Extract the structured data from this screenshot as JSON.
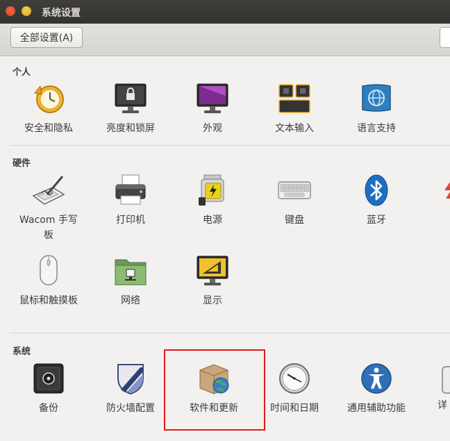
{
  "window": {
    "title": "系统设置",
    "all_settings_button": "全部设置(A)"
  },
  "sections": {
    "personal": {
      "title": "个人",
      "items": [
        {
          "label": "安全和隐私"
        },
        {
          "label": "亮度和锁屏"
        },
        {
          "label": "外观"
        },
        {
          "label": "文本输入"
        },
        {
          "label": "语言支持"
        }
      ]
    },
    "hardware": {
      "title": "硬件",
      "items": [
        {
          "label": "Wacom 手写板"
        },
        {
          "label": "打印机"
        },
        {
          "label": "电源"
        },
        {
          "label": "键盘"
        },
        {
          "label": "蓝牙"
        },
        {
          "label": "鼠标和触摸板"
        },
        {
          "label": "网络"
        },
        {
          "label": "显示"
        }
      ]
    },
    "system": {
      "title": "系统",
      "items": [
        {
          "label": "备份"
        },
        {
          "label": "防火墙配置"
        },
        {
          "label": "软件和更新"
        },
        {
          "label": "时间和日期"
        },
        {
          "label": "通用辅助功能"
        },
        {
          "label": "详"
        }
      ]
    }
  },
  "highlight_color": "#e01a1a"
}
